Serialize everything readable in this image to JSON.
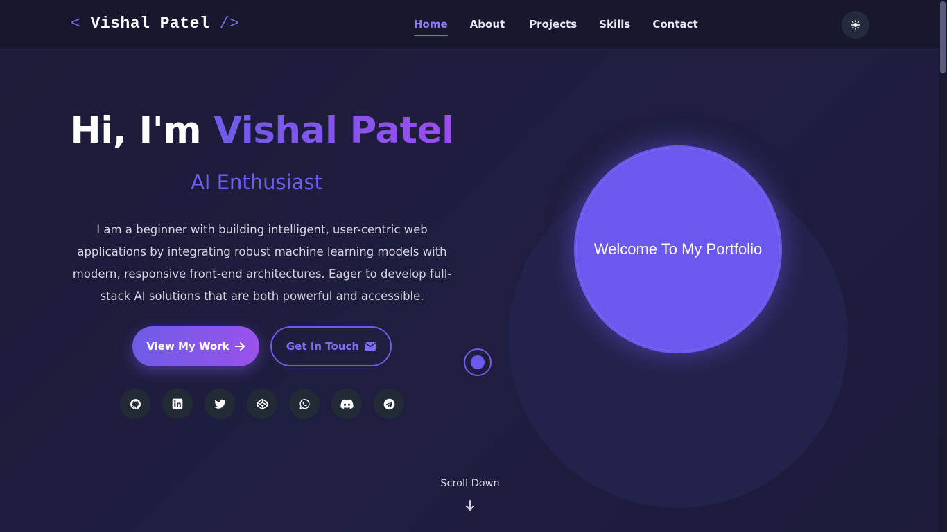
{
  "logo": {
    "open": "<",
    "name": "Vishal Patel",
    "close": "/>"
  },
  "nav": {
    "items": [
      "Home",
      "About",
      "Projects",
      "Skills",
      "Contact"
    ],
    "active": "Home"
  },
  "theme_toggle": {
    "icon": "sun-icon"
  },
  "hero": {
    "greeting": "Hi, I'm",
    "name": "Vishal Patel",
    "role": "AI Enthusiast",
    "description": "I am a beginner with building intelligent, user-centric web applications by integrating robust machine learning models with modern, responsive front-end architectures. Eager to develop full-stack AI solutions that are both powerful and accessible.",
    "primary_button": {
      "label": "View My Work",
      "icon": "arrow-right-icon"
    },
    "secondary_button": {
      "label": "Get In Touch",
      "icon": "envelope-icon"
    },
    "socials": [
      "github-icon",
      "linkedin-icon",
      "twitter-icon",
      "codepen-icon",
      "whatsapp-icon",
      "discord-icon",
      "telegram-icon"
    ]
  },
  "visual": {
    "welcome_text": "Welcome To My Portfolio"
  },
  "scroll": {
    "label": "Scroll Down",
    "icon": "arrow-down-icon"
  },
  "colors": {
    "accent": "#6b58ec",
    "accent_purple": "#9a52ec",
    "background": "#1e1d3e",
    "navbar": "#17172e"
  }
}
